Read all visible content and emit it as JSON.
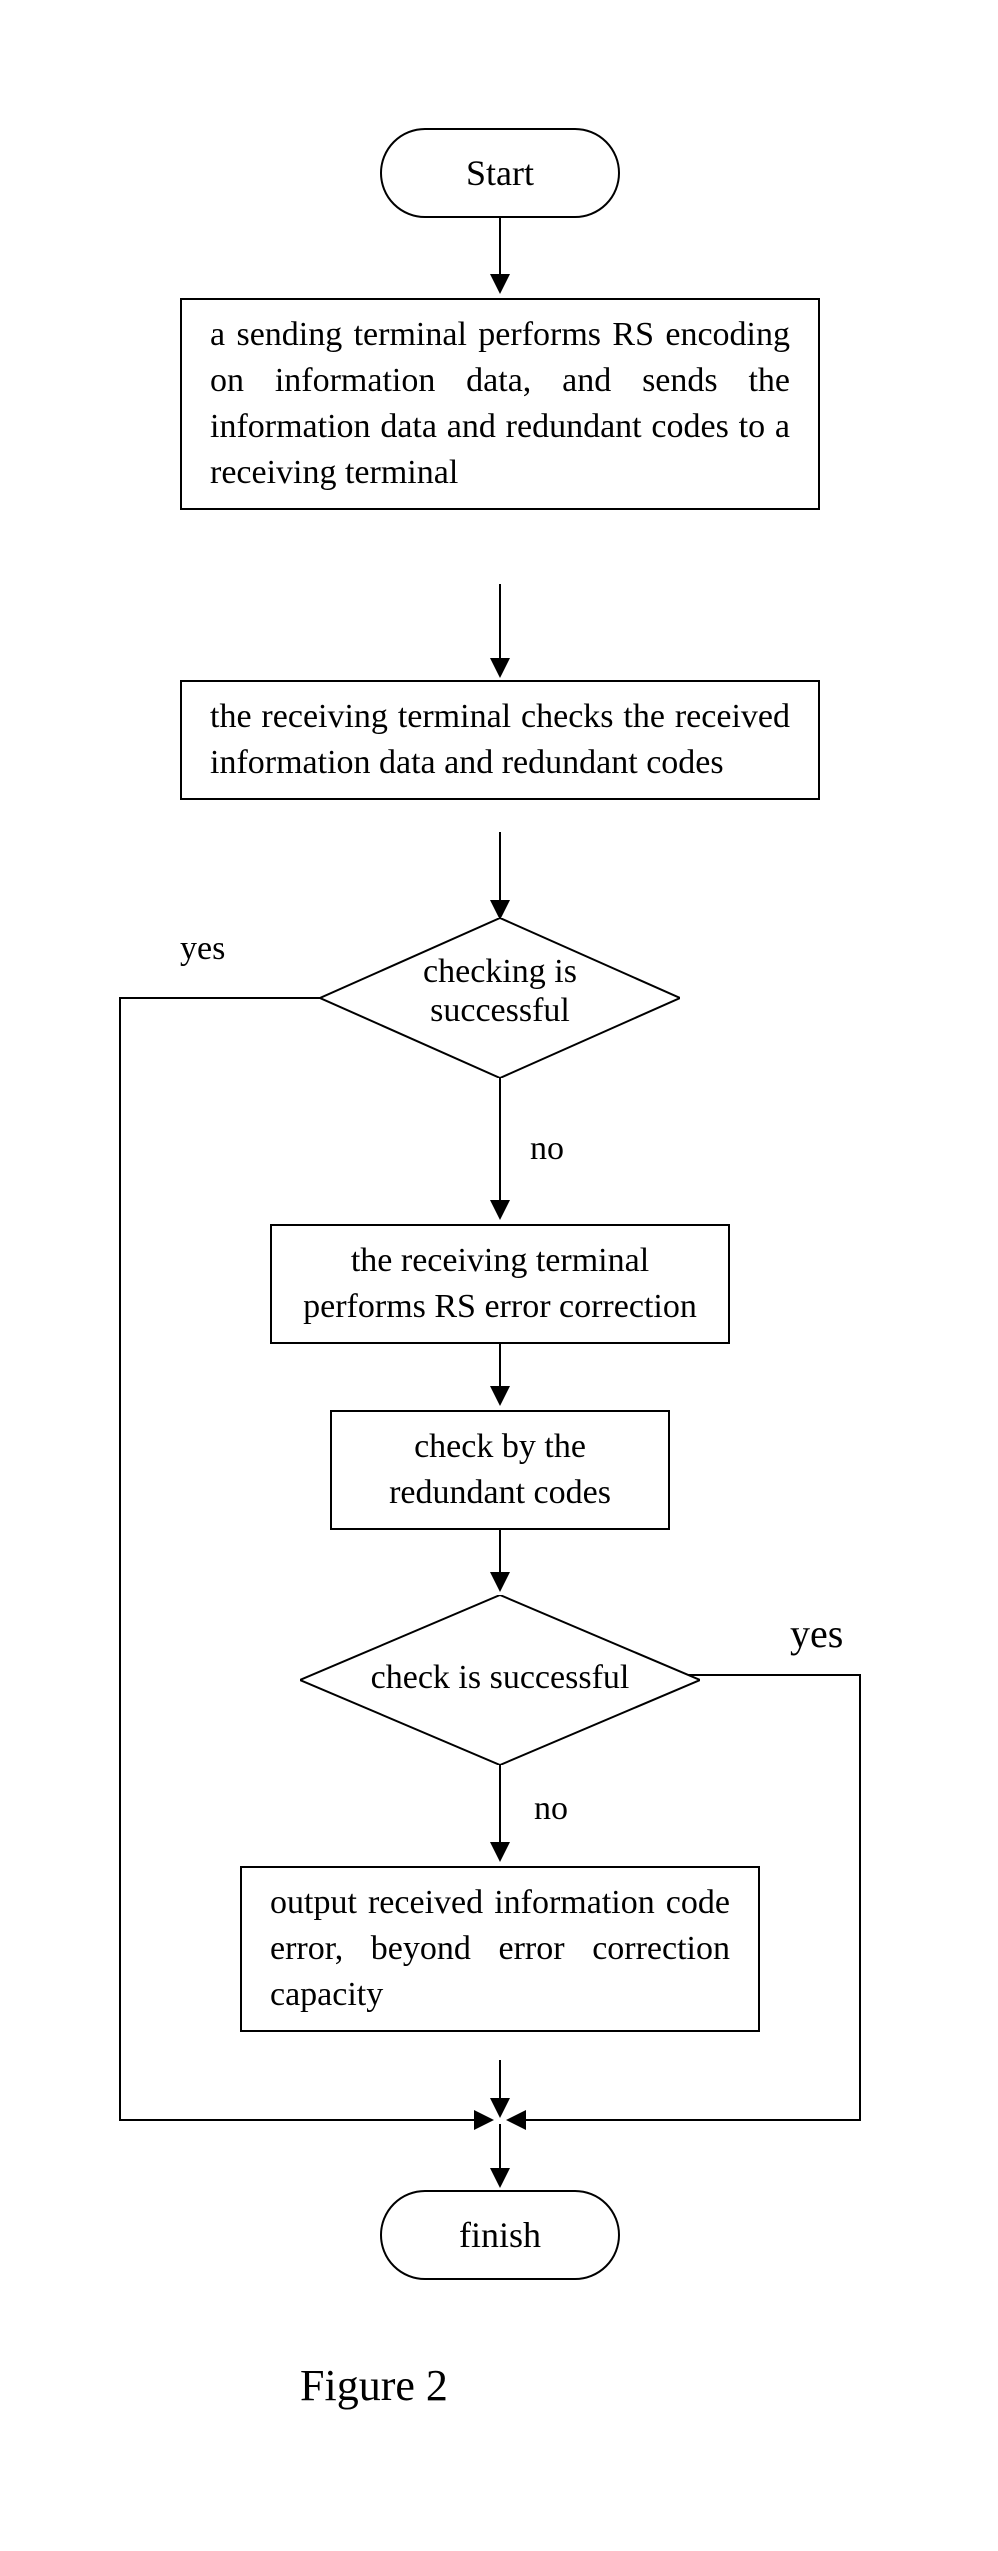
{
  "nodes": {
    "start": "Start",
    "step1": "a sending terminal performs RS encoding on information data, and sends the information data and redundant codes to a receiving terminal",
    "step2": "the receiving terminal checks the received information data and redundant codes",
    "decision1": "checking is successful",
    "step3": "the receiving terminal performs RS error correction",
    "step4": "check by the redundant codes",
    "decision2": "check is successful",
    "step5": "output received information code error, beyond error correction capacity",
    "finish": "finish"
  },
  "edges": {
    "d1_yes": "yes",
    "d1_no": "no",
    "d2_yes": "yes",
    "d2_no": "no"
  },
  "caption": "Figure 2"
}
